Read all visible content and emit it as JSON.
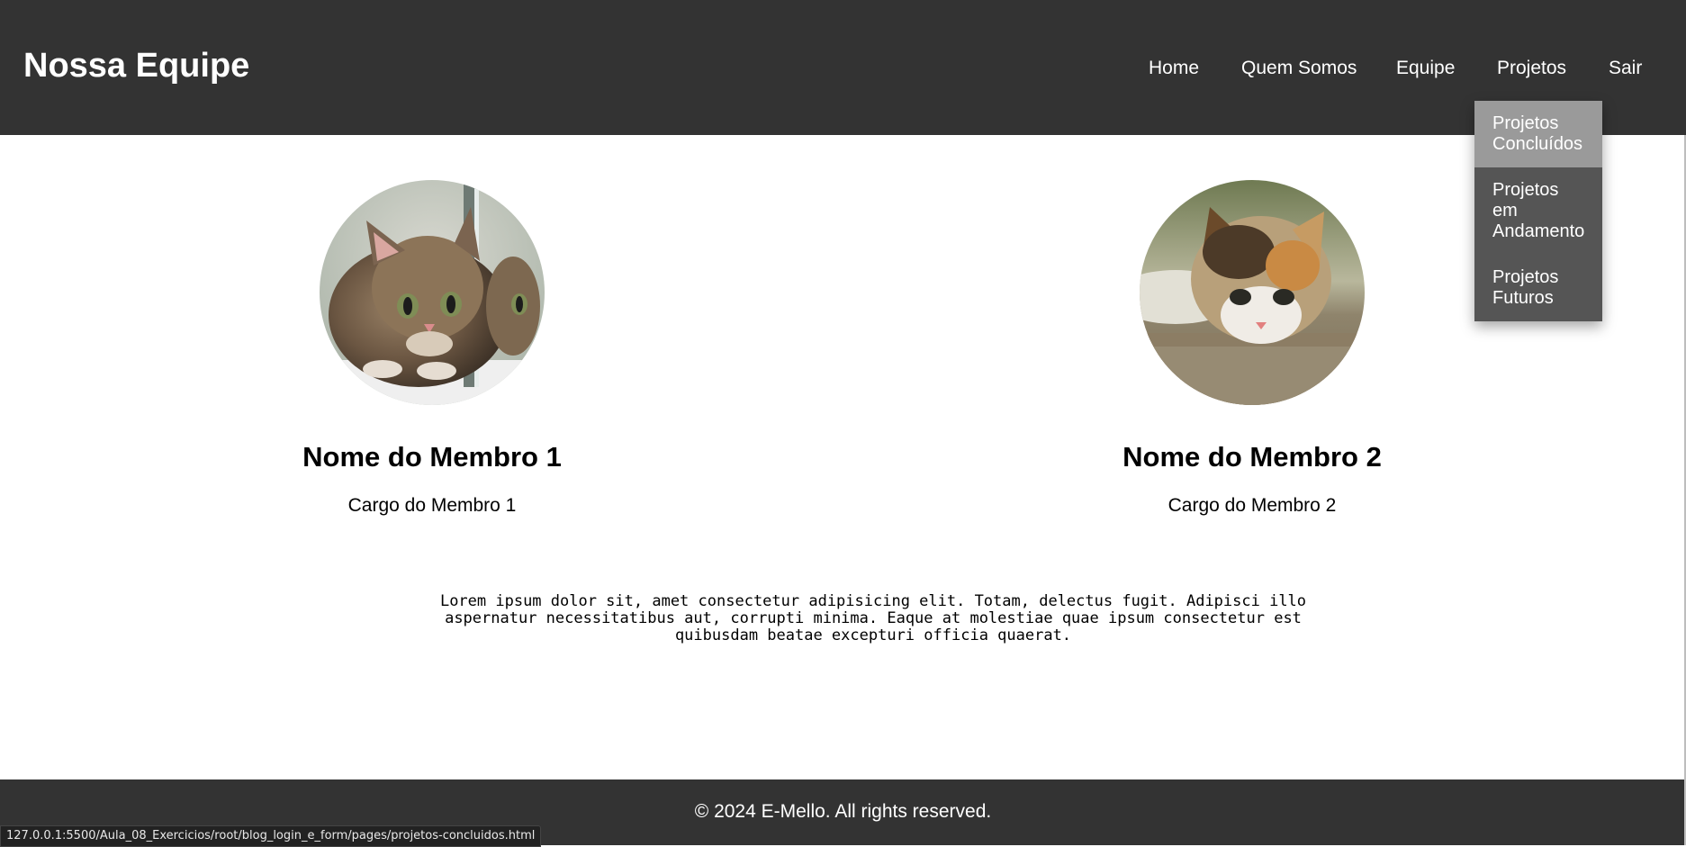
{
  "header": {
    "title": "Nossa Equipe",
    "nav": [
      "Home",
      "Quem Somos",
      "Equipe",
      "Projetos",
      "Sair"
    ],
    "dropdown": [
      "Projetos Concluídos",
      "Projetos em Andamento",
      "Projetos Futuros"
    ]
  },
  "members": [
    {
      "name": "Nome do Membro 1",
      "role": "Cargo do Membro 1",
      "photo": "kitten-photo-1"
    },
    {
      "name": "Nome do Membro 2",
      "role": "Cargo do Membro 2",
      "photo": "kitten-photo-2"
    }
  ],
  "content": {
    "text": "Lorem ipsum dolor sit, amet consectetur adipisicing elit. Totam, delectus fugit. Adipisci illo aspernatur necessitatibus aut, corrupti minima. Eaque at molestiae quae ipsum consectetur est quibusdam beatae excepturi officia quaerat."
  },
  "footer": {
    "text": "© 2024 E-Mello. All rights reserved."
  },
  "status_bar": {
    "url": "127.0.0.1:5500/Aula_08_Exercicios/root/blog_login_e_form/pages/projetos-concluidos.html"
  },
  "colors": {
    "header_bg": "#333333",
    "dropdown_bg": "#555555",
    "dropdown_hover": "#9a9a9a",
    "footer_bg": "#333333"
  }
}
